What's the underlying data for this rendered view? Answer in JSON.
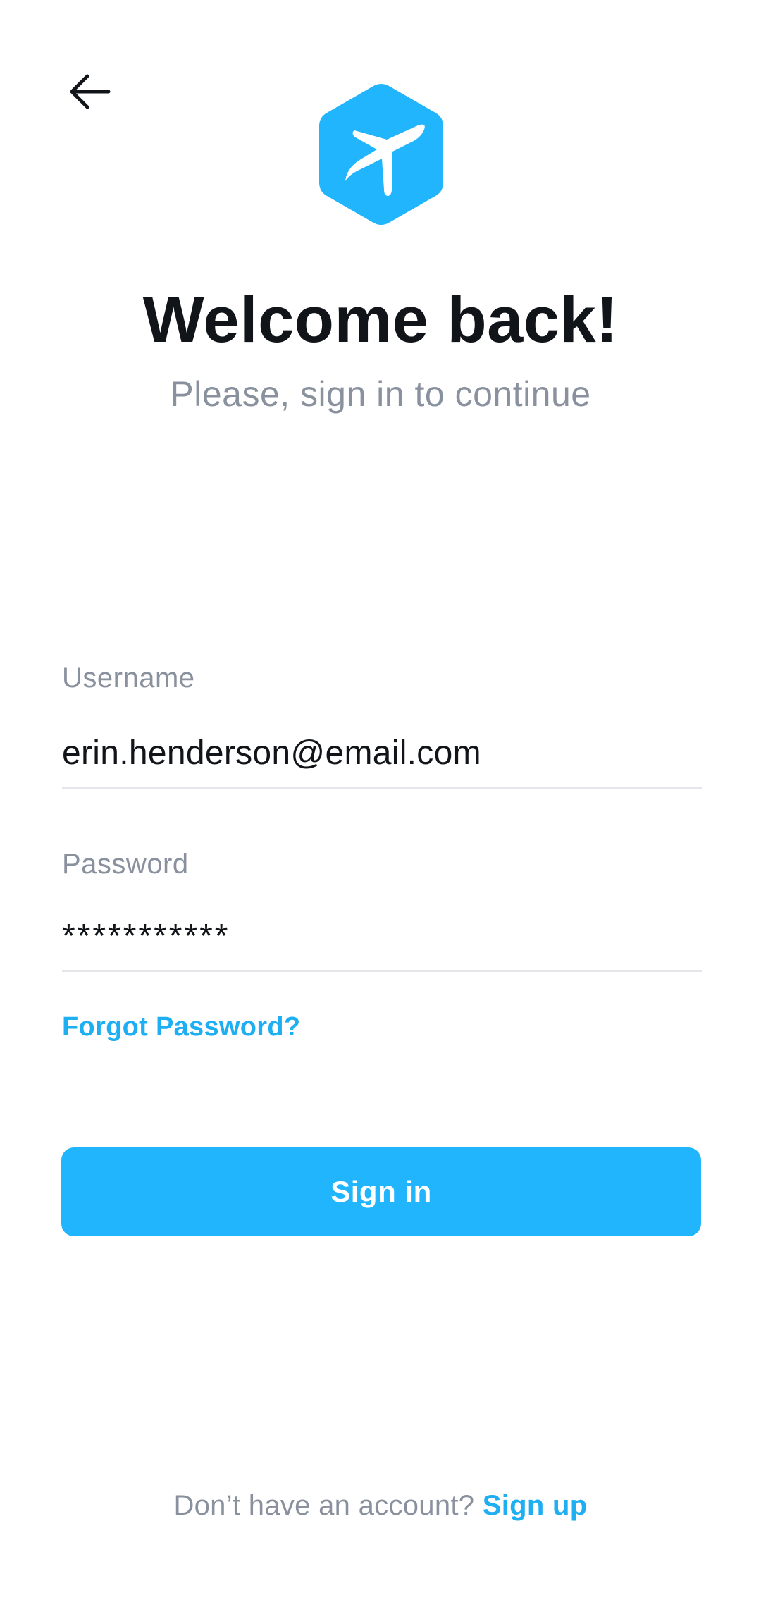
{
  "header": {
    "back_icon": "arrow-left-icon",
    "logo_icon": "airplane-hexagon-icon"
  },
  "colors": {
    "brand": "#20b5fc",
    "link": "#1eaef2",
    "title": "#111418",
    "muted": "#8a919e",
    "divider": "#e4e6ea"
  },
  "hero": {
    "title": "Welcome back!",
    "subtitle": "Please, sign in to continue"
  },
  "form": {
    "username": {
      "label": "Username",
      "value": "erin.henderson@email.com"
    },
    "password": {
      "label": "Password",
      "value": "***********"
    },
    "forgot_label": "Forgot Password?",
    "submit_label": "Sign in"
  },
  "footer": {
    "prompt": "Don’t have an account?",
    "signup_label": "Sign up"
  }
}
